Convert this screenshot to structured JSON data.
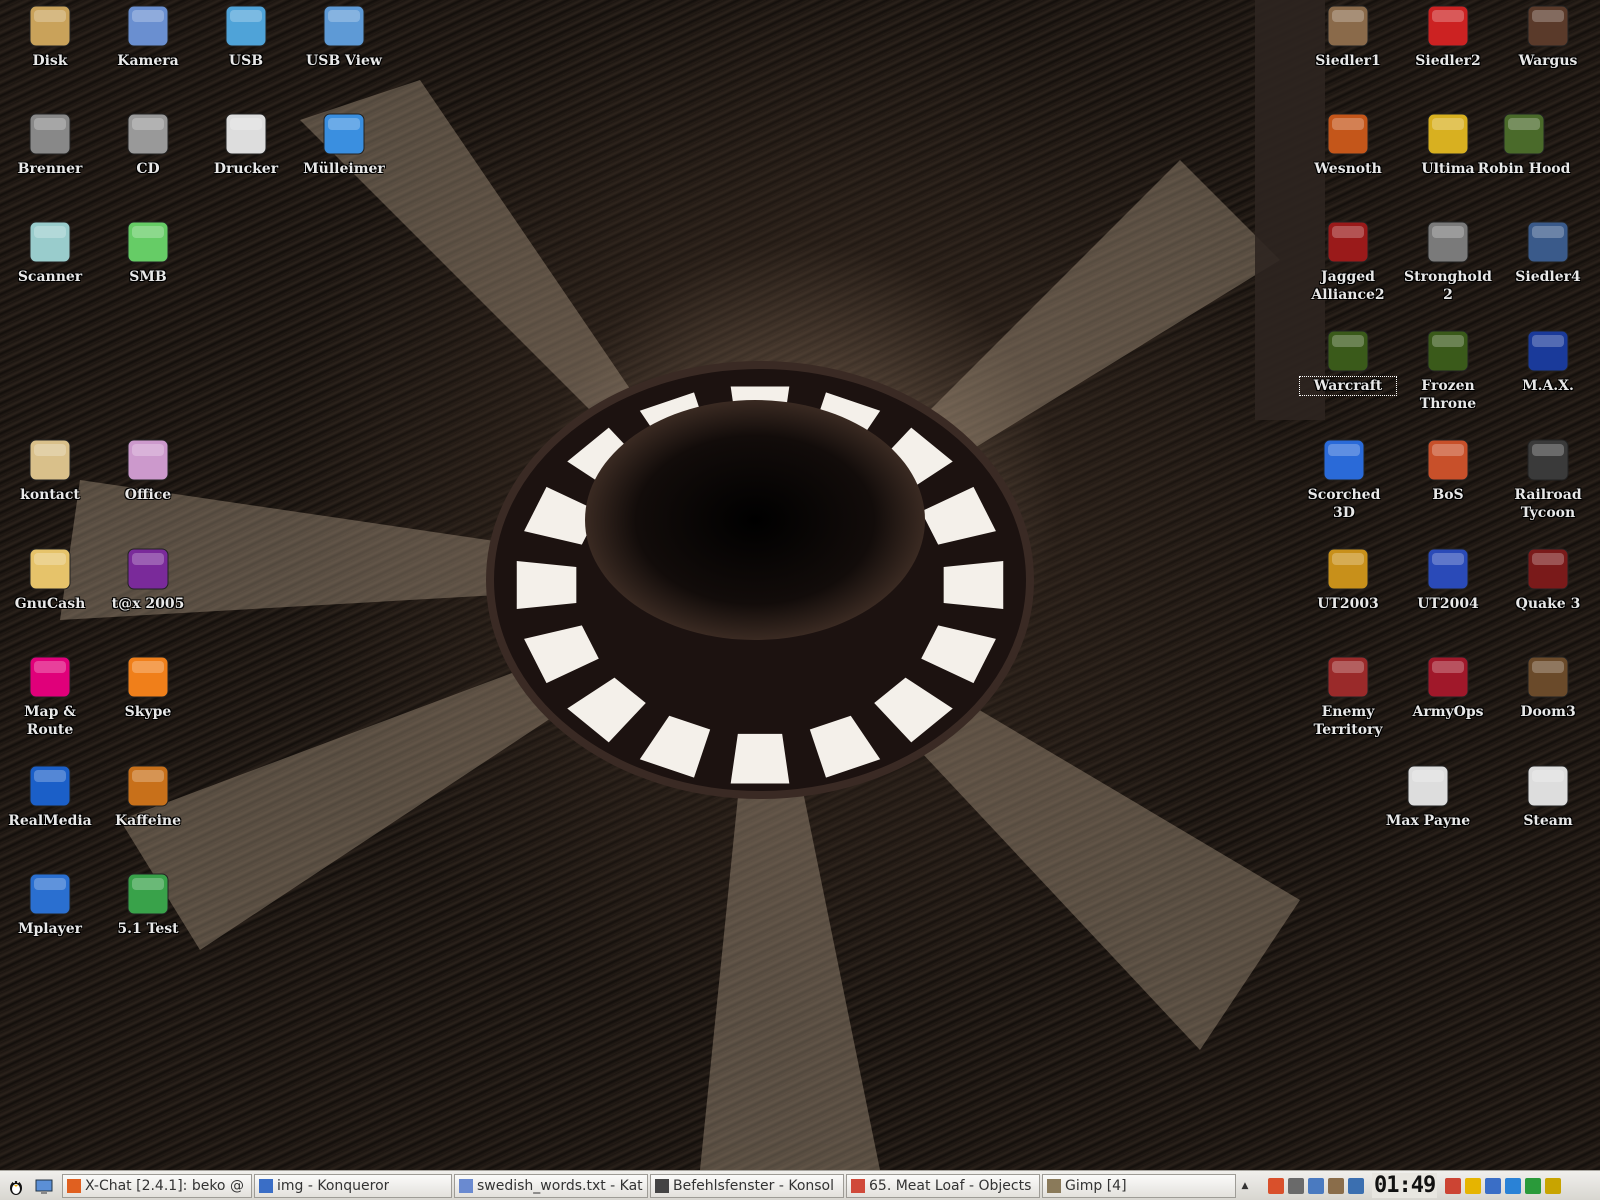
{
  "desktop": {
    "icons": [
      {
        "label": "Disk",
        "icon": "floppy-disk-icon"
      },
      {
        "label": "Kamera",
        "icon": "camera-icon"
      },
      {
        "label": "USB",
        "icon": "usb-stick-icon"
      },
      {
        "label": "USB View",
        "icon": "usb-view-icon"
      },
      {
        "label": "Brenner",
        "icon": "cd-burner-icon"
      },
      {
        "label": "CD",
        "icon": "cd-icon"
      },
      {
        "label": "Drucker",
        "icon": "printer-icon"
      },
      {
        "label": "Mülleimer",
        "icon": "trash-icon"
      },
      {
        "label": "Scanner",
        "icon": "scanner-icon"
      },
      {
        "label": "SMB",
        "icon": "network-icon"
      },
      {
        "label": "kontact",
        "icon": "kontact-icon"
      },
      {
        "label": "Office",
        "icon": "butterfly-icon"
      },
      {
        "label": "GnuCash",
        "icon": "gnucash-icon"
      },
      {
        "label": "t@x 2005",
        "icon": "at-sign-icon"
      },
      {
        "label": "Map & Route",
        "icon": "telekom-icon"
      },
      {
        "label": "Skype",
        "icon": "skype-icon"
      },
      {
        "label": "RealMedia",
        "icon": "real-icon"
      },
      {
        "label": "Kaffeine",
        "icon": "coffee-bean-icon"
      },
      {
        "label": "Mplayer",
        "icon": "clapper-icon"
      },
      {
        "label": "5.1 Test",
        "icon": "speaker-icon"
      },
      {
        "label": "Siedler1",
        "icon": "game-siedler1-icon"
      },
      {
        "label": "Siedler2",
        "icon": "game-siedler2-icon"
      },
      {
        "label": "Wargus",
        "icon": "game-warcraft2-icon"
      },
      {
        "label": "Wesnoth",
        "icon": "game-wesnoth-icon"
      },
      {
        "label": "Ultima",
        "icon": "game-ultima-icon"
      },
      {
        "label": "Robin Hood",
        "icon": "game-robinhood-icon"
      },
      {
        "label": "Jagged Alliance2",
        "icon": "game-jagged-icon"
      },
      {
        "label": "Stronghold2",
        "icon": "game-stronghold-icon"
      },
      {
        "label": "Siedler4",
        "icon": "game-siedler4-icon"
      },
      {
        "label": "Warcraft",
        "icon": "game-warcraft-icon"
      },
      {
        "label": "Frozen Throne",
        "icon": "game-frozen-icon"
      },
      {
        "label": "M.A.X.",
        "icon": "game-max-icon"
      },
      {
        "label": "Scorched 3D",
        "icon": "game-scorched-icon"
      },
      {
        "label": "BoS",
        "icon": "game-bos-icon"
      },
      {
        "label": "Railroad Tycoon",
        "icon": "game-tycoon-icon"
      },
      {
        "label": "UT2003",
        "icon": "game-ut2003-icon"
      },
      {
        "label": "UT2004",
        "icon": "game-ut2004-icon"
      },
      {
        "label": "Quake 3",
        "icon": "game-quake-icon"
      },
      {
        "label": "Enemy Territory",
        "icon": "game-enemy-icon"
      },
      {
        "label": "ArmyOps",
        "icon": "game-armyops-icon"
      },
      {
        "label": "Doom3",
        "icon": "game-doom-icon"
      },
      {
        "label": "Max Payne",
        "icon": "game-maxpayne-icon"
      },
      {
        "label": "Steam",
        "icon": "steam-icon"
      }
    ]
  },
  "taskbar": {
    "tasks": [
      {
        "label": "X-Chat [2.4.1]: beko @",
        "icon": "xchat-icon"
      },
      {
        "label": "img - Konqueror",
        "icon": "konqueror-icon"
      },
      {
        "label": "swedish_words.txt - Kat",
        "icon": "kate-icon"
      },
      {
        "label": "Befehlsfenster - Konsol",
        "icon": "konsole-icon"
      },
      {
        "label": "65. Meat Loaf - Objects",
        "icon": "media-icon"
      },
      {
        "label": "Gimp [4]",
        "icon": "gimp-icon"
      }
    ],
    "scroll_glyph": "▲",
    "clock": "01:49",
    "colors": {
      "bar": "#e2e0da",
      "clock": "#111111"
    }
  }
}
